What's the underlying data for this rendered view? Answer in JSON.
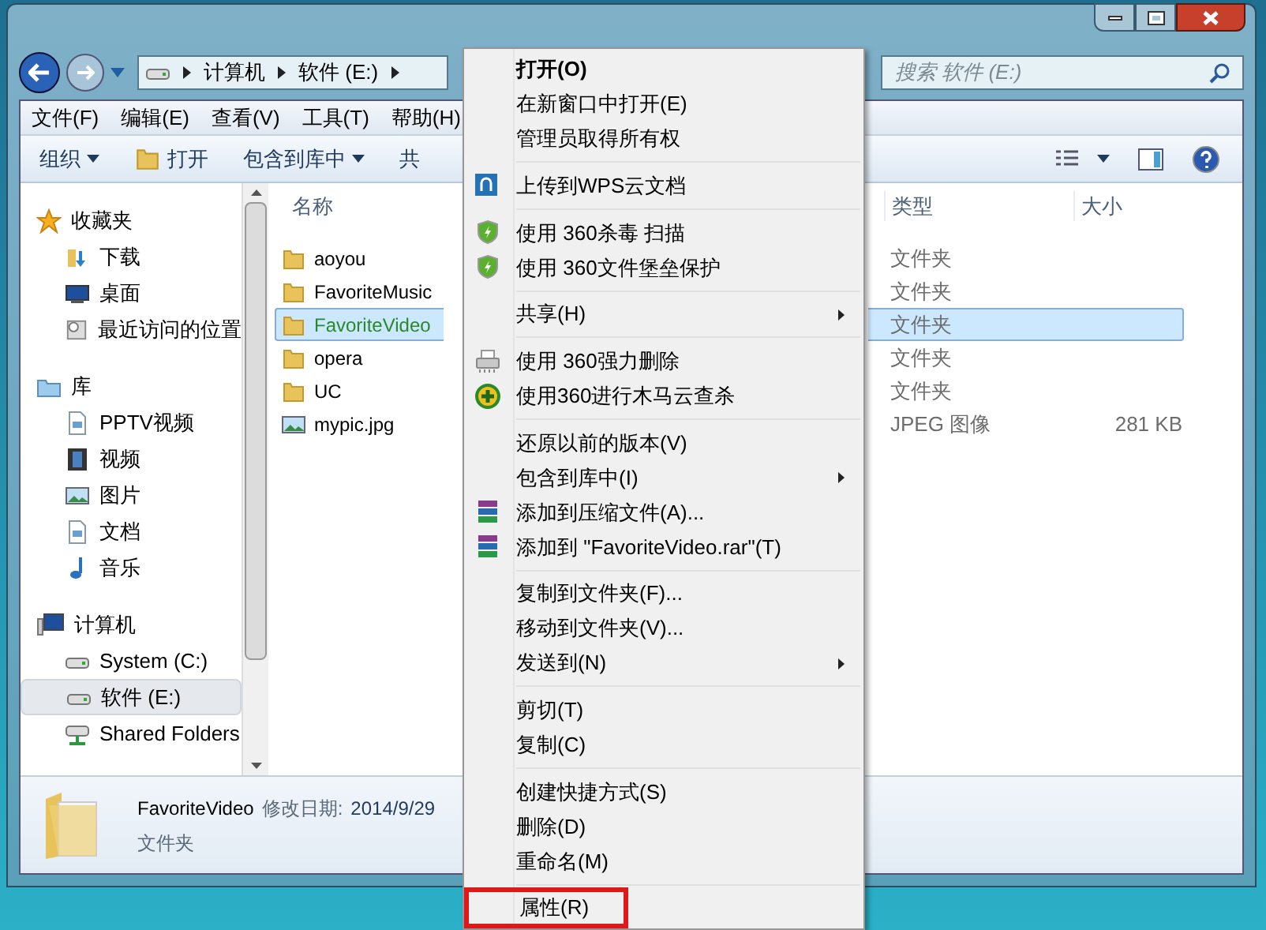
{
  "address_bar": {
    "crumbs": [
      "计算机",
      "软件 (E:)"
    ]
  },
  "search": {
    "placeholder": "搜索 软件 (E:)"
  },
  "menu_bar": [
    "文件(F)",
    "编辑(E)",
    "查看(V)",
    "工具(T)",
    "帮助(H)"
  ],
  "toolbar": [
    {
      "label": "组织",
      "kind": "dropdown"
    },
    {
      "label": "打开",
      "kind": "open"
    },
    {
      "label": "包含到库中",
      "kind": "dropdown"
    },
    {
      "label": "共",
      "kind": "plain"
    }
  ],
  "sidebar": {
    "groups": [
      {
        "label": "收藏夹",
        "kind": "star",
        "children": [
          {
            "label": "下载",
            "kind": "download",
            "selected": false
          },
          {
            "label": "桌面",
            "kind": "desktop",
            "selected": false
          },
          {
            "label": "最近访问的位置",
            "kind": "recent",
            "selected": false
          }
        ]
      },
      {
        "label": "库",
        "kind": "library",
        "children": [
          {
            "label": "PPTV视频",
            "kind": "document",
            "selected": false
          },
          {
            "label": "视频",
            "kind": "film",
            "selected": false
          },
          {
            "label": "图片",
            "kind": "picture",
            "selected": false
          },
          {
            "label": "文档",
            "kind": "document",
            "selected": false
          },
          {
            "label": "音乐",
            "kind": "music",
            "selected": false
          }
        ]
      },
      {
        "label": "计算机",
        "kind": "computer",
        "children": [
          {
            "label": "System (C:)",
            "kind": "drive",
            "selected": false
          },
          {
            "label": "软件 (E:)",
            "kind": "drive",
            "selected": true
          },
          {
            "label": "Shared Folders",
            "kind": "network",
            "selected": false
          }
        ]
      }
    ]
  },
  "file_list": {
    "columns": [
      "名称",
      "类型",
      "大小"
    ],
    "rows": [
      {
        "name": "aoyou",
        "type": "文件夹",
        "kind": "folder",
        "selected": false
      },
      {
        "name": "FavoriteMusic",
        "type": "文件夹",
        "kind": "folder",
        "selected": false
      },
      {
        "name": "FavoriteVideo",
        "type": "文件夹",
        "kind": "folder",
        "selected": true
      },
      {
        "name": "opera",
        "type": "文件夹",
        "kind": "folder",
        "selected": false
      },
      {
        "name": "UC",
        "type": "文件夹",
        "kind": "folder",
        "selected": false
      },
      {
        "name": "mypic.jpg",
        "type": "JPEG 图像",
        "size": "281 KB",
        "kind": "image",
        "selected": false
      }
    ]
  },
  "details_pane": {
    "name": "FavoriteVideo",
    "modified_label": "修改日期:",
    "modified": "2014/9/29",
    "type": "文件夹"
  },
  "context_menu": [
    {
      "label": "打开(O)",
      "kind": "default"
    },
    {
      "label": "在新窗口中打开(E)",
      "kind": "text"
    },
    {
      "label": "管理员取得所有权",
      "kind": "text"
    },
    {
      "kind": "separator"
    },
    {
      "label": "上传到WPS云文档",
      "kind": "cloud"
    },
    {
      "kind": "separator"
    },
    {
      "label": "使用 360杀毒 扫描",
      "kind": "shield"
    },
    {
      "label": "使用 360文件堡垒保护",
      "kind": "shield"
    },
    {
      "kind": "separator"
    },
    {
      "label": "共享(H)",
      "kind": "submenu"
    },
    {
      "kind": "separator"
    },
    {
      "label": "使用 360强力删除",
      "kind": "shredder"
    },
    {
      "label": "使用360进行木马云查杀",
      "kind": "plus"
    },
    {
      "kind": "separator"
    },
    {
      "label": "还原以前的版本(V)",
      "kind": "text"
    },
    {
      "label": "包含到库中(I)",
      "kind": "submenu"
    },
    {
      "label": "添加到压缩文件(A)...",
      "kind": "archive"
    },
    {
      "label": "添加到 \"FavoriteVideo.rar\"(T)",
      "kind": "archive"
    },
    {
      "kind": "separator"
    },
    {
      "label": "复制到文件夹(F)...",
      "kind": "text"
    },
    {
      "label": "移动到文件夹(V)...",
      "kind": "text"
    },
    {
      "label": "发送到(N)",
      "kind": "submenu"
    },
    {
      "kind": "separator"
    },
    {
      "label": "剪切(T)",
      "kind": "text"
    },
    {
      "label": "复制(C)",
      "kind": "text"
    },
    {
      "kind": "separator"
    },
    {
      "label": "创建快捷方式(S)",
      "kind": "text"
    },
    {
      "label": "删除(D)",
      "kind": "text"
    },
    {
      "label": "重命名(M)",
      "kind": "text"
    },
    {
      "kind": "separator"
    },
    {
      "label": "属性(R)",
      "kind": "text",
      "highlighted": true
    }
  ]
}
